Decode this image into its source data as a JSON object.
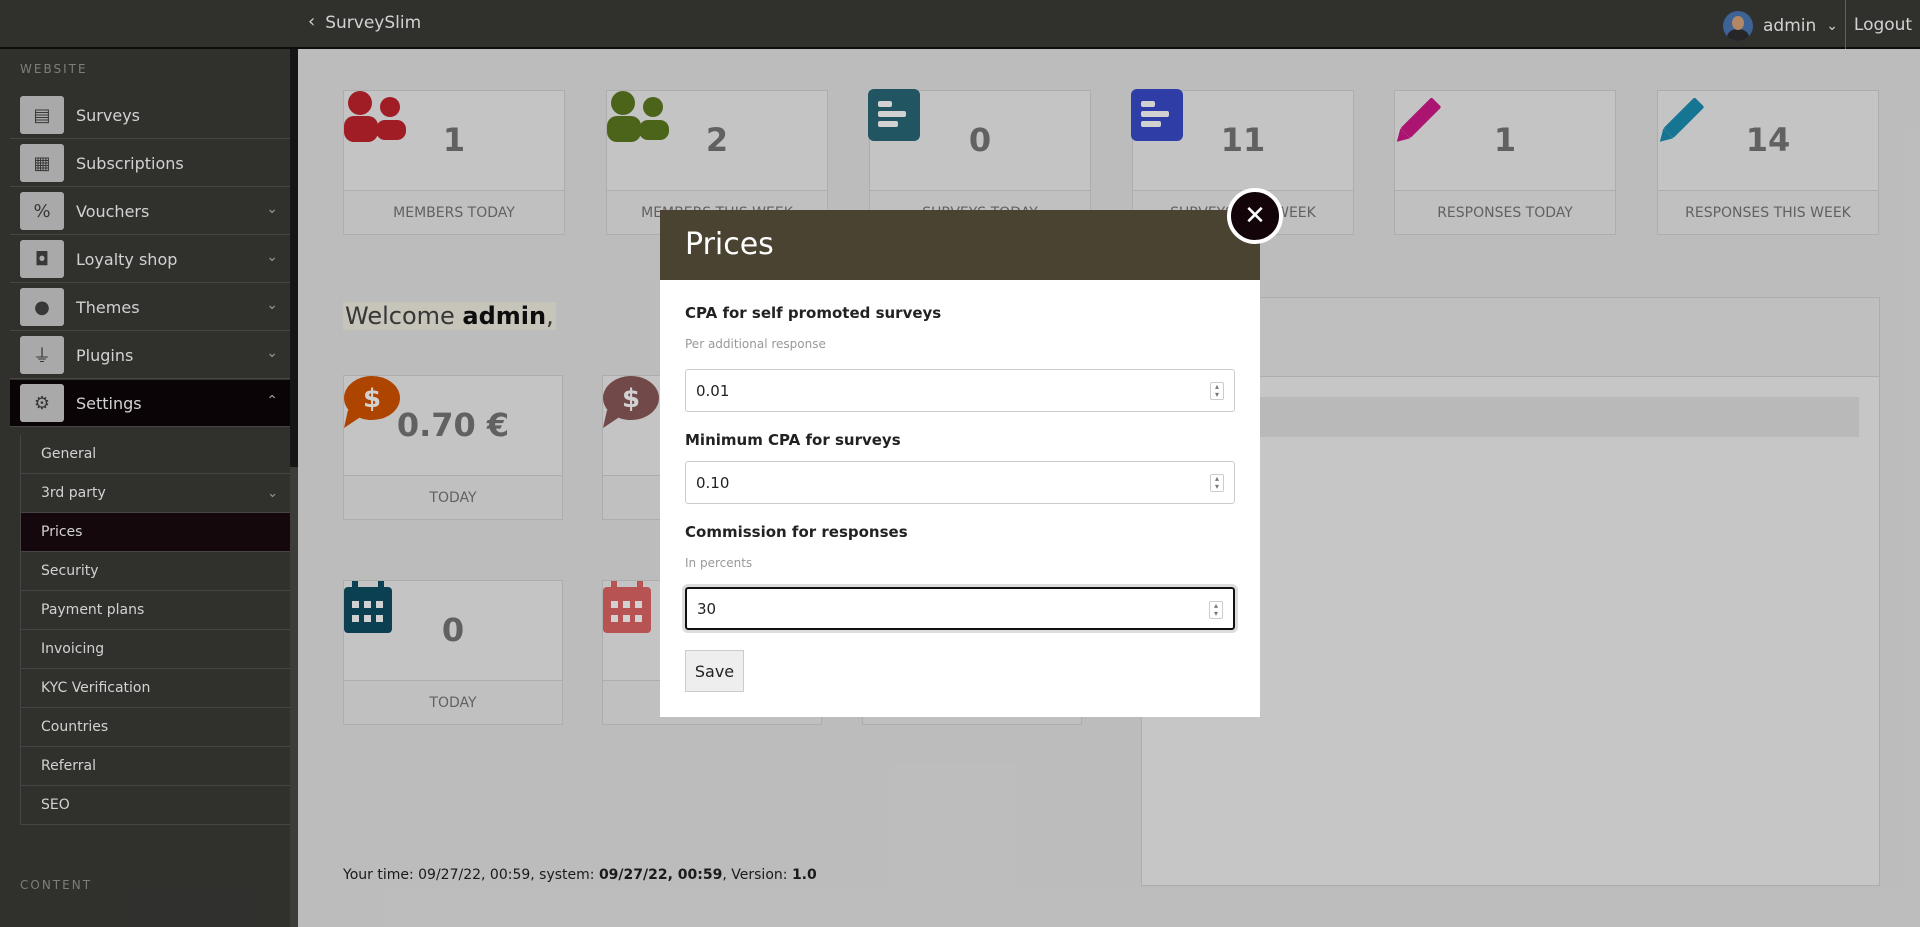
{
  "topbar": {
    "brand": "SurveySlim",
    "user": "admin",
    "logout": "Logout"
  },
  "sidebar": {
    "section_website": "WEBSITE",
    "section_content": "CONTENT",
    "items": [
      {
        "label": "Surveys",
        "icon": "survey-icon"
      },
      {
        "label": "Subscriptions",
        "icon": "calendar-icon"
      },
      {
        "label": "Vouchers",
        "icon": "percent-icon"
      },
      {
        "label": "Loyalty shop",
        "icon": "shopping-bag-icon"
      },
      {
        "label": "Themes",
        "icon": "palette-icon"
      },
      {
        "label": "Plugins",
        "icon": "plug-icon"
      },
      {
        "label": "Settings",
        "icon": "gears-icon"
      }
    ],
    "sub_items": [
      "General",
      "3rd party",
      "Prices",
      "Security",
      "Payment plans",
      "Invoicing",
      "KYC Verification",
      "Countries",
      "Referral",
      "SEO"
    ]
  },
  "stats": [
    {
      "value": "1",
      "label": "MEMBERS TODAY",
      "color": "#c4242f"
    },
    {
      "value": "2",
      "label": "MEMBERS THIS WEEK",
      "color": "#5c7a1f"
    },
    {
      "value": "0",
      "label": "SURVEYS TODAY",
      "color": "#2a6878"
    },
    {
      "value": "11",
      "label": "SURVEYS THIS WEEK",
      "color": "#3a4ccc"
    },
    {
      "value": "1",
      "label": "RESPONSES TODAY",
      "color": "#d11a8a"
    },
    {
      "value": "14",
      "label": "RESPONSES THIS WEEK",
      "color": "#1a8fb3"
    }
  ],
  "welcome": {
    "prefix": "Welcome",
    "name": "admin",
    "suffix": ","
  },
  "earnings": {
    "value": "0.70 €",
    "label": "TODAY"
  },
  "calendar": {
    "value": "0",
    "label": "TODAY"
  },
  "footer": {
    "prefix": "Your time: 09/27/22, 00:59, system: ",
    "system": "09/27/22, 00:59",
    "mid": ", Version: ",
    "version": "1.0"
  },
  "modal": {
    "title": "Prices",
    "fields": [
      {
        "label": "CPA for self promoted surveys",
        "hint": "Per additional response",
        "value": "0.01"
      },
      {
        "label": "Minimum CPA for surveys",
        "hint": "",
        "value": "0.10"
      },
      {
        "label": "Commission for responses",
        "hint": "In percents",
        "value": "30"
      }
    ],
    "save": "Save"
  }
}
